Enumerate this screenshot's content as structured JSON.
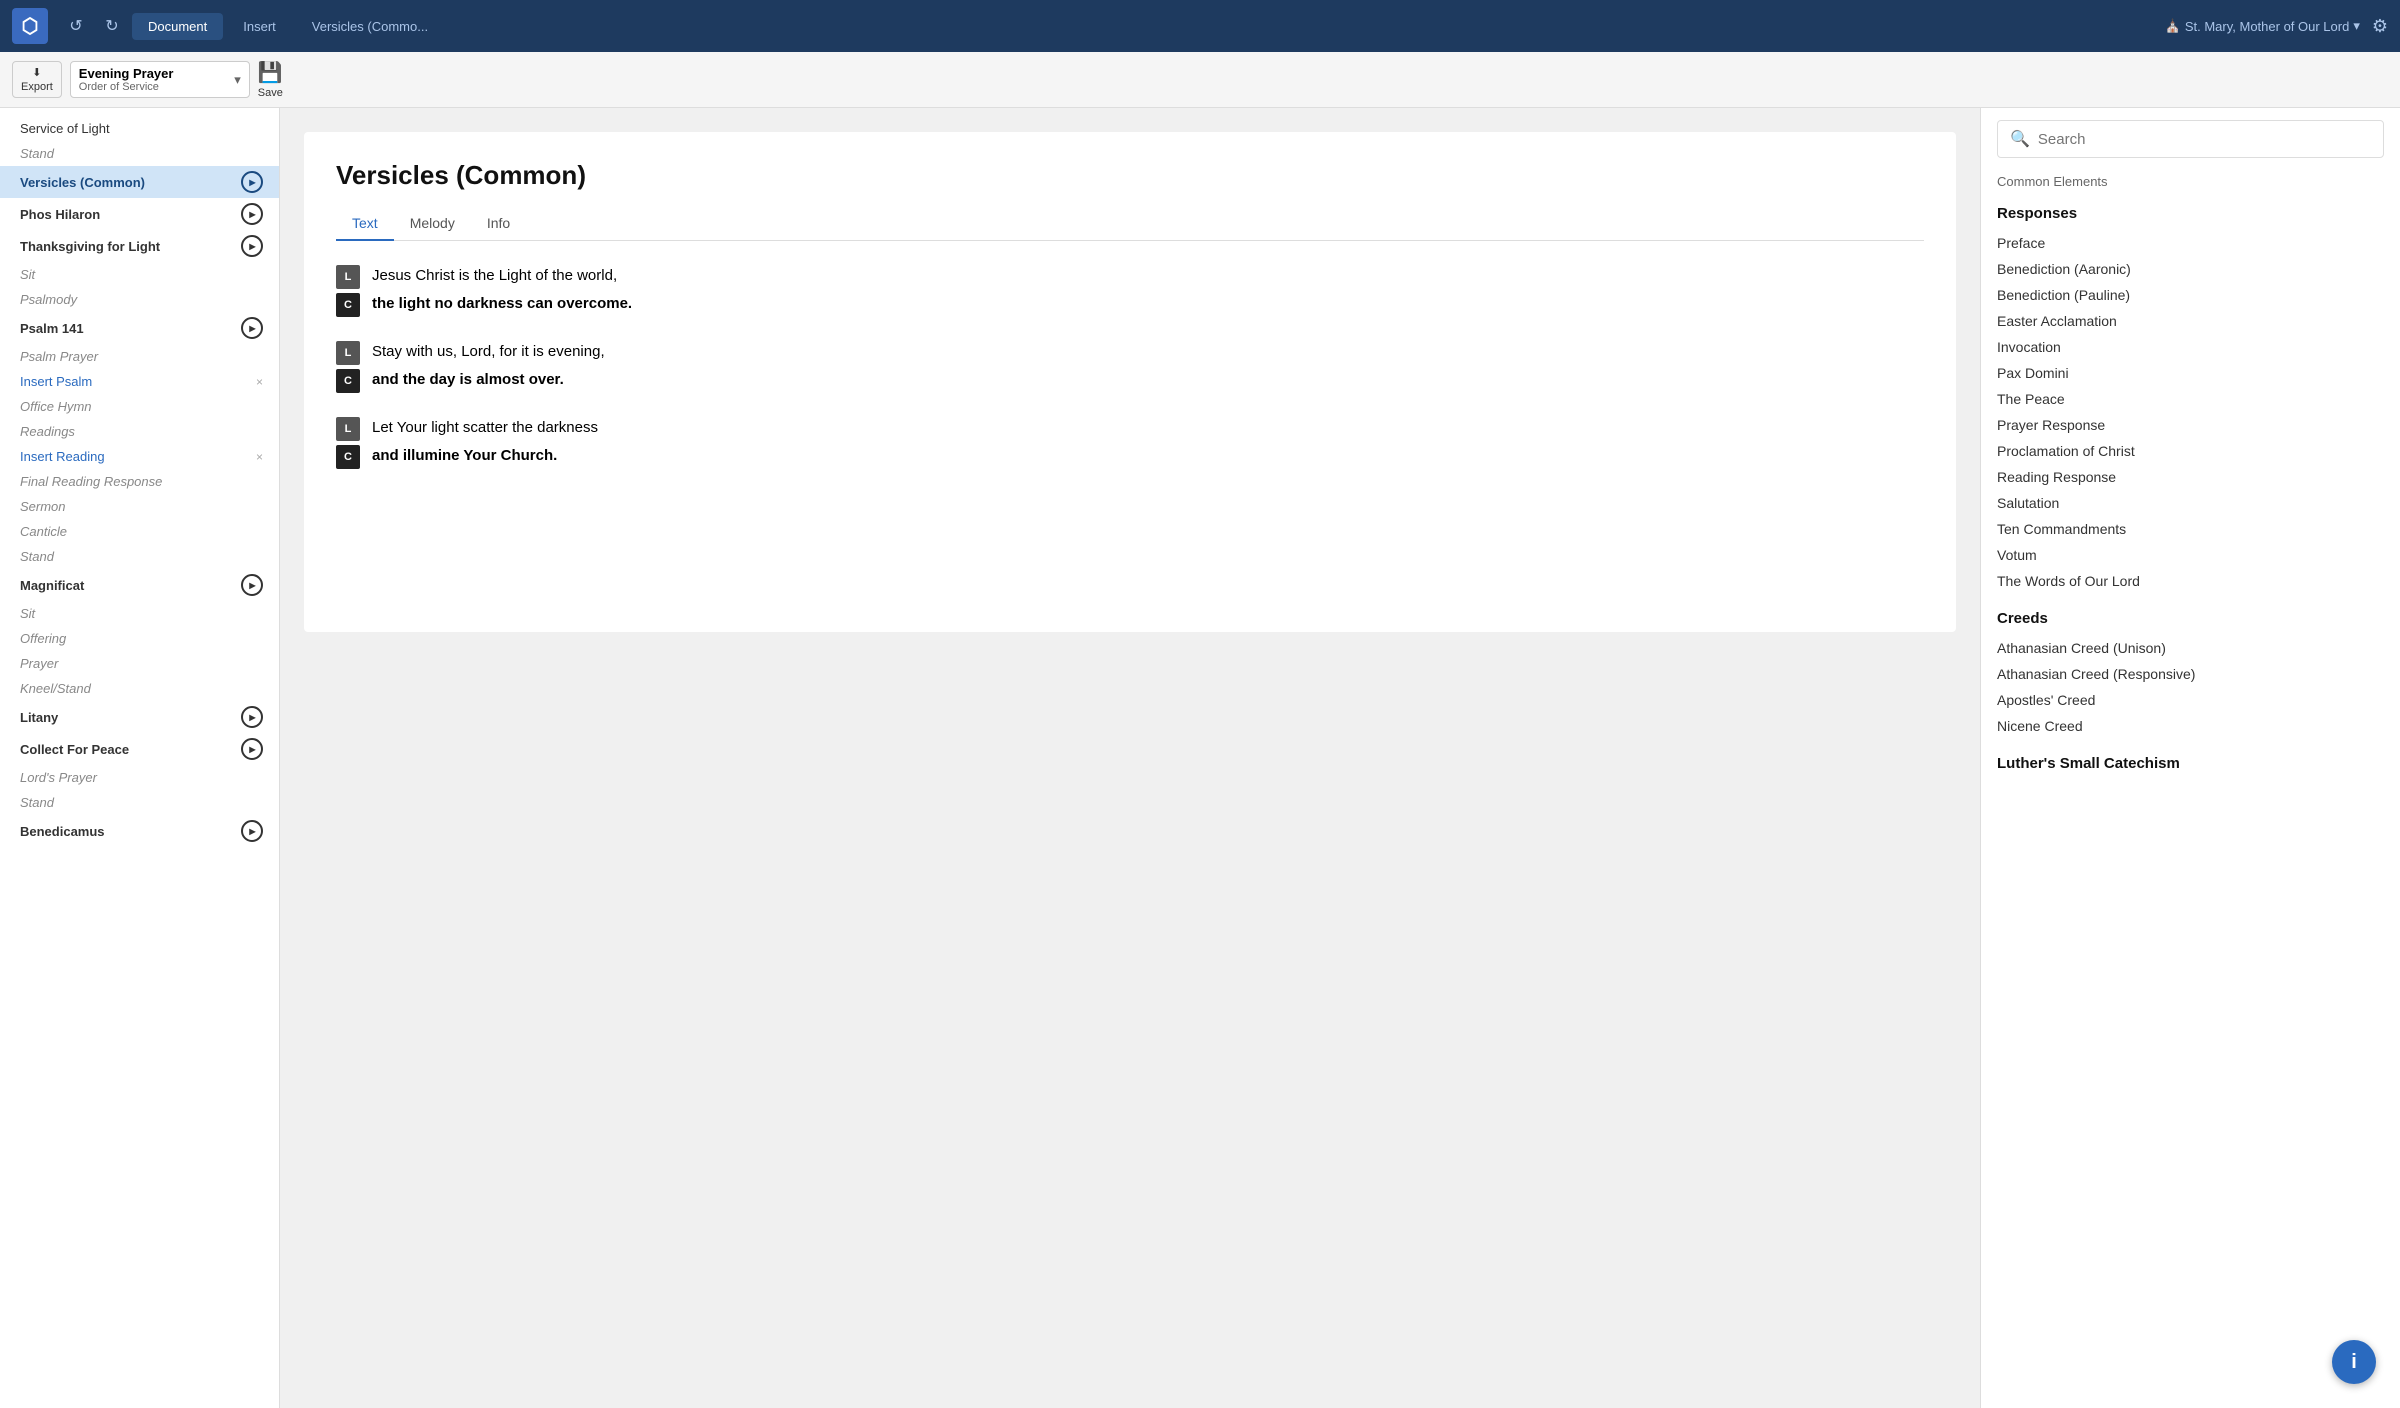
{
  "topbar": {
    "undo_label": "↺",
    "redo_label": "↻",
    "tabs": [
      {
        "id": "document",
        "label": "Document",
        "active": true
      },
      {
        "id": "insert",
        "label": "Insert",
        "active": false
      },
      {
        "id": "versicles",
        "label": "Versicles (Commo...",
        "active": false
      }
    ],
    "church": "St. Mary, Mother of Our Lord"
  },
  "toolbar": {
    "export_label": "Export",
    "export_icon": "⬇",
    "doc_title": "Evening Prayer",
    "doc_subtitle": "Order of Service",
    "save_label": "Save",
    "save_icon": "💾"
  },
  "sidebar": {
    "items": [
      {
        "id": "service-of-light",
        "label": "Service of Light",
        "style": "normal",
        "hasPlay": false,
        "hasClose": false,
        "active": false,
        "hasDrag": false
      },
      {
        "id": "stand",
        "label": "Stand",
        "style": "italic",
        "hasPlay": false,
        "hasClose": false,
        "active": false,
        "hasDrag": false
      },
      {
        "id": "versicles-common",
        "label": "Versicles (Common)",
        "style": "bold",
        "hasPlay": true,
        "hasClose": false,
        "active": true,
        "hasDrag": false
      },
      {
        "id": "phos-hilaron",
        "label": "Phos Hilaron",
        "style": "bold",
        "hasPlay": true,
        "hasClose": false,
        "active": false,
        "hasDrag": false
      },
      {
        "id": "thanksgiving-for-light",
        "label": "Thanksgiving for Light",
        "style": "bold",
        "hasPlay": true,
        "hasClose": false,
        "active": false,
        "hasDrag": true
      },
      {
        "id": "sit",
        "label": "Sit",
        "style": "italic",
        "hasPlay": false,
        "hasClose": false,
        "active": false,
        "hasDrag": false
      },
      {
        "id": "psalmody",
        "label": "Psalmody",
        "style": "italic",
        "hasPlay": false,
        "hasClose": false,
        "active": false,
        "hasDrag": false
      },
      {
        "id": "psalm-141",
        "label": "Psalm 141",
        "style": "bold",
        "hasPlay": true,
        "hasClose": false,
        "active": false,
        "hasDrag": false
      },
      {
        "id": "psalm-prayer",
        "label": "Psalm Prayer",
        "style": "italic",
        "hasPlay": false,
        "hasClose": false,
        "active": false,
        "hasDrag": false
      },
      {
        "id": "insert-psalm",
        "label": "Insert Psalm",
        "style": "link",
        "hasPlay": false,
        "hasClose": true,
        "active": false,
        "hasDrag": false
      },
      {
        "id": "office-hymn",
        "label": "Office Hymn",
        "style": "italic",
        "hasPlay": false,
        "hasClose": false,
        "active": false,
        "hasDrag": false
      },
      {
        "id": "readings",
        "label": "Readings",
        "style": "italic",
        "hasPlay": false,
        "hasClose": false,
        "active": false,
        "hasDrag": false
      },
      {
        "id": "insert-reading",
        "label": "Insert Reading",
        "style": "link",
        "hasPlay": false,
        "hasClose": true,
        "active": false,
        "hasDrag": false
      },
      {
        "id": "final-reading-response",
        "label": "Final Reading Response",
        "style": "italic",
        "hasPlay": false,
        "hasClose": false,
        "active": false,
        "hasDrag": false
      },
      {
        "id": "sermon",
        "label": "Sermon",
        "style": "italic",
        "hasPlay": false,
        "hasClose": false,
        "active": false,
        "hasDrag": true
      },
      {
        "id": "canticle",
        "label": "Canticle",
        "style": "italic",
        "hasPlay": false,
        "hasClose": false,
        "active": false,
        "hasDrag": false
      },
      {
        "id": "stand2",
        "label": "Stand",
        "style": "italic",
        "hasPlay": false,
        "hasClose": false,
        "active": false,
        "hasDrag": false
      },
      {
        "id": "magnificat",
        "label": "Magnificat",
        "style": "bold",
        "hasPlay": true,
        "hasClose": false,
        "active": false,
        "hasDrag": true
      },
      {
        "id": "sit2",
        "label": "Sit",
        "style": "italic",
        "hasPlay": false,
        "hasClose": false,
        "active": false,
        "hasDrag": false
      },
      {
        "id": "offering",
        "label": "Offering",
        "style": "italic",
        "hasPlay": false,
        "hasClose": false,
        "active": false,
        "hasDrag": false
      },
      {
        "id": "prayer",
        "label": "Prayer",
        "style": "italic",
        "hasPlay": false,
        "hasClose": false,
        "active": false,
        "hasDrag": false
      },
      {
        "id": "kneel-stand",
        "label": "Kneel/Stand",
        "style": "italic",
        "hasPlay": false,
        "hasClose": false,
        "active": false,
        "hasDrag": false
      },
      {
        "id": "litany",
        "label": "Litany",
        "style": "bold",
        "hasPlay": true,
        "hasClose": false,
        "active": false,
        "hasDrag": true
      },
      {
        "id": "collect-for-peace",
        "label": "Collect For Peace",
        "style": "bold",
        "hasPlay": true,
        "hasClose": false,
        "active": false,
        "hasDrag": false
      },
      {
        "id": "lords-prayer",
        "label": "Lord's Prayer",
        "style": "italic",
        "hasPlay": false,
        "hasClose": false,
        "active": false,
        "hasDrag": false
      },
      {
        "id": "stand3",
        "label": "Stand",
        "style": "italic",
        "hasPlay": false,
        "hasClose": false,
        "active": false,
        "hasDrag": false
      },
      {
        "id": "benedicamus",
        "label": "Benedicamus",
        "style": "bold",
        "hasPlay": true,
        "hasClose": false,
        "active": false,
        "hasDrag": false
      }
    ]
  },
  "content": {
    "title": "Versicles (Common)",
    "tabs": [
      {
        "id": "text",
        "label": "Text",
        "active": true
      },
      {
        "id": "melody",
        "label": "Melody",
        "active": false
      },
      {
        "id": "info",
        "label": "Info",
        "active": false
      }
    ],
    "versicles": [
      {
        "lines": [
          {
            "role": "L",
            "text": "Jesus Christ is the Light of the world,",
            "bold": false
          },
          {
            "role": "C",
            "text": "the light no darkness can overcome.",
            "bold": true
          }
        ]
      },
      {
        "lines": [
          {
            "role": "L",
            "text": "Stay with us, Lord, for it is evening,",
            "bold": false
          },
          {
            "role": "C",
            "text": "and the day is almost over.",
            "bold": true
          }
        ]
      },
      {
        "lines": [
          {
            "role": "L",
            "text": "Let Your light scatter the darkness",
            "bold": false
          },
          {
            "role": "C",
            "text": "and illumine Your Church.",
            "bold": true
          }
        ]
      }
    ]
  },
  "rightpanel": {
    "search_placeholder": "Search",
    "section_header": "Common Elements",
    "groups": [
      {
        "title": "Responses",
        "items": [
          "Preface",
          "Benediction (Aaronic)",
          "Benediction (Pauline)",
          "Easter Acclamation",
          "Invocation",
          "Pax Domini",
          "The Peace",
          "Prayer Response",
          "Proclamation of Christ",
          "Reading Response",
          "Salutation",
          "Ten Commandments",
          "Votum",
          "The Words of Our Lord"
        ]
      },
      {
        "title": "Creeds",
        "items": [
          "Athanasian Creed (Unison)",
          "Athanasian Creed (Responsive)",
          "Apostles' Creed",
          "Nicene Creed"
        ]
      },
      {
        "title": "Luther's Small Catechism",
        "items": []
      }
    ]
  },
  "info_fab_label": "i"
}
